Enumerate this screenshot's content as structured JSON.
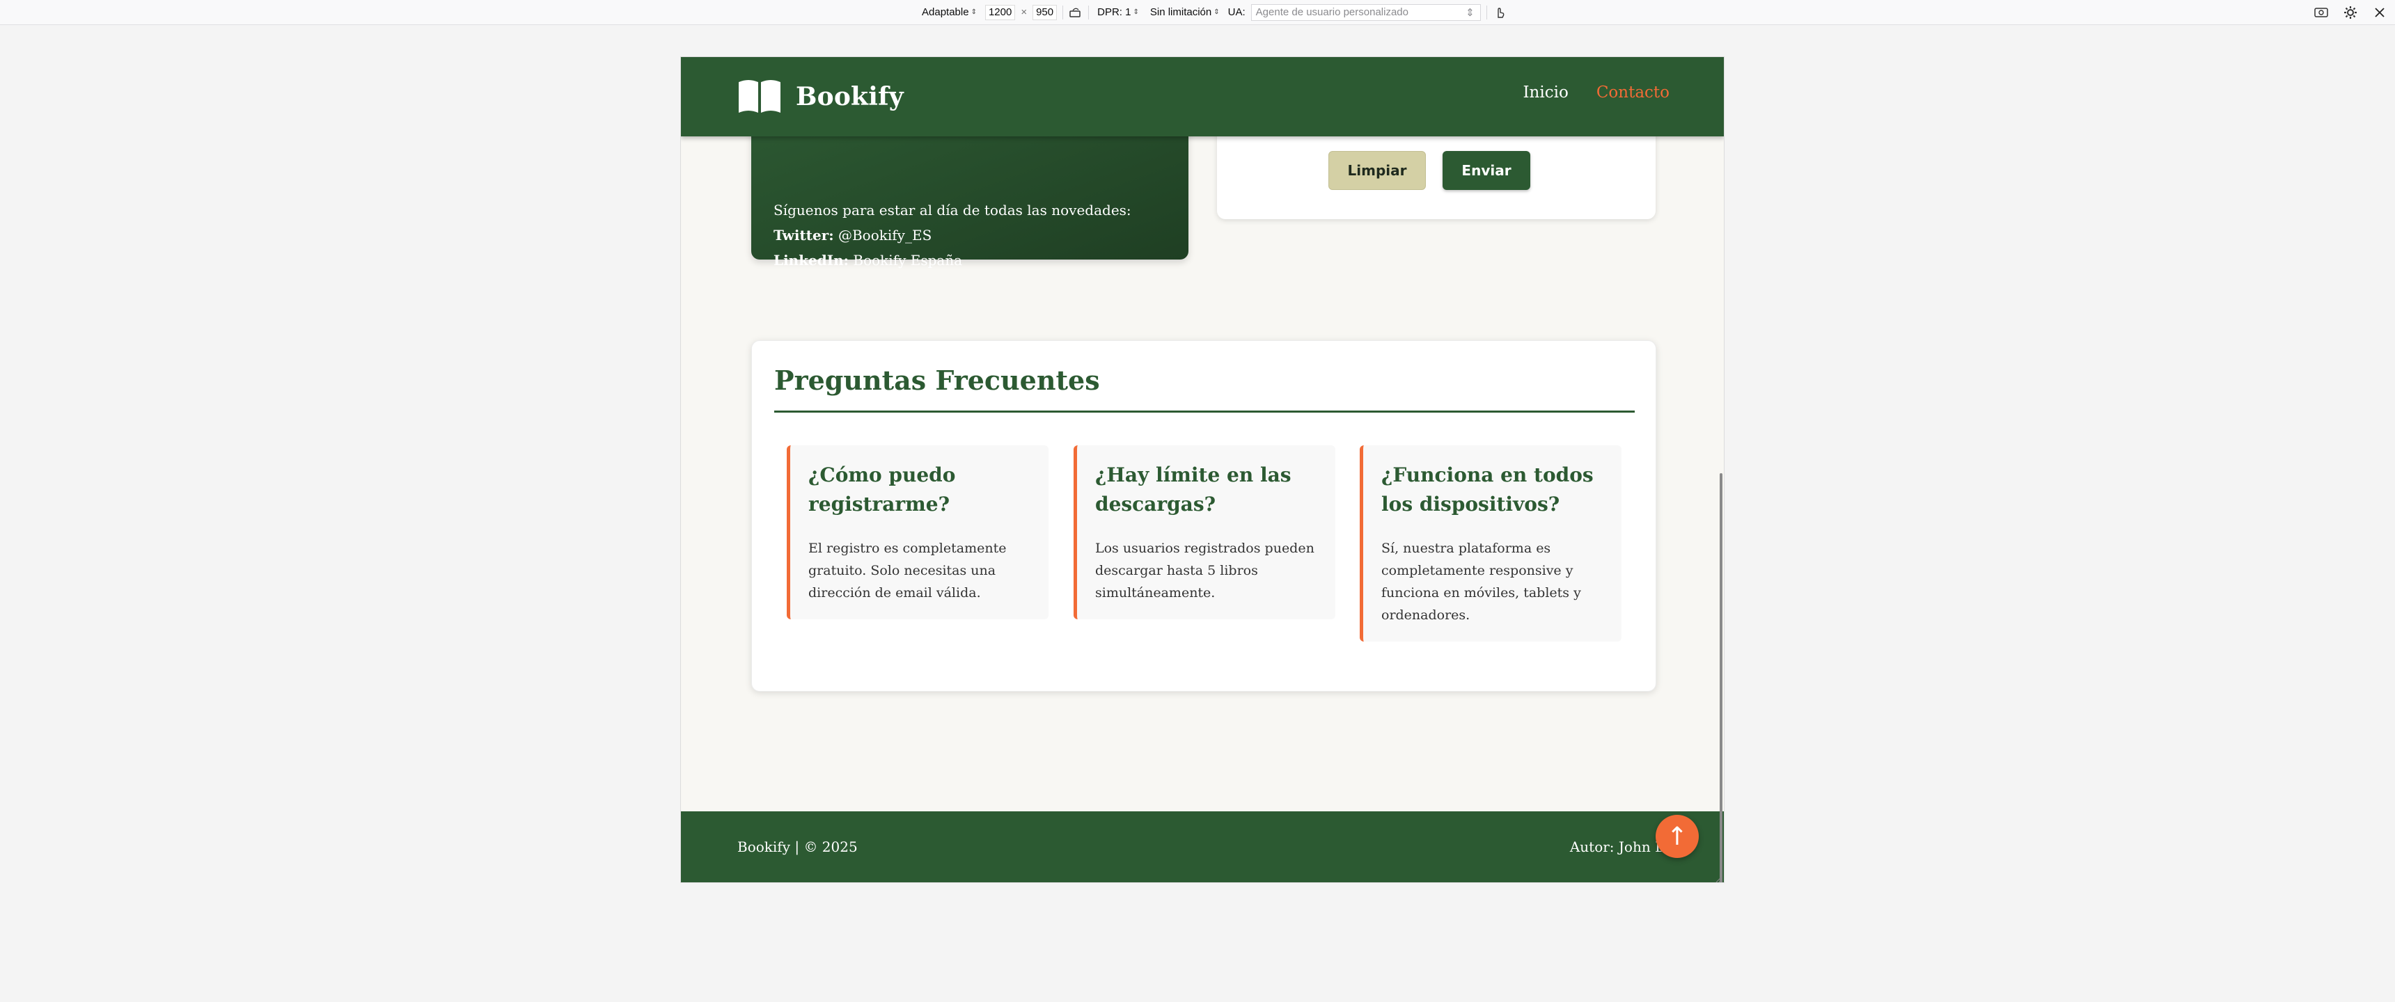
{
  "devtools": {
    "device_mode": "Adaptable",
    "width": "1200",
    "times": "×",
    "height": "950",
    "dpr": "DPR: 1",
    "throttling": "Sin limitación",
    "ua_label": "UA:",
    "ua_placeholder": "Agente de usuario personalizado"
  },
  "header": {
    "brand": "Bookify",
    "nav": [
      {
        "label": "Inicio",
        "active": false
      },
      {
        "label": "Contacto",
        "active": true
      }
    ]
  },
  "contact": {
    "social_intro": "Síguenos para estar al día de todas las novedades:",
    "twitter_label": "Twitter:",
    "twitter_value": "@Bookify_ES",
    "linkedin_label": "LinkedIn:",
    "linkedin_value": "Bookify España",
    "clear_label": "Limpiar",
    "send_label": "Enviar"
  },
  "faq": {
    "title": "Preguntas Frecuentes",
    "items": [
      {
        "q": "¿Cómo puedo registrarme?",
        "a": "El registro es completamente gratuito. Solo necesitas una dirección de email válida."
      },
      {
        "q": "¿Hay límite en las descargas?",
        "a": "Los usuarios registrados pueden descargar hasta 5 libros simultáneamente."
      },
      {
        "q": "¿Funciona en todos los dispositivos?",
        "a": "Sí, nuestra plataforma es completamente responsive y funciona en móviles, tablets y ordenadores."
      }
    ]
  },
  "footer": {
    "left": "Bookify | © 2025",
    "right": "Autor: John Doe"
  },
  "back_to_top": "↑",
  "colors": {
    "primary": "#2c5a32",
    "accent": "#f26b36",
    "page_bg": "#f8f7f3"
  }
}
